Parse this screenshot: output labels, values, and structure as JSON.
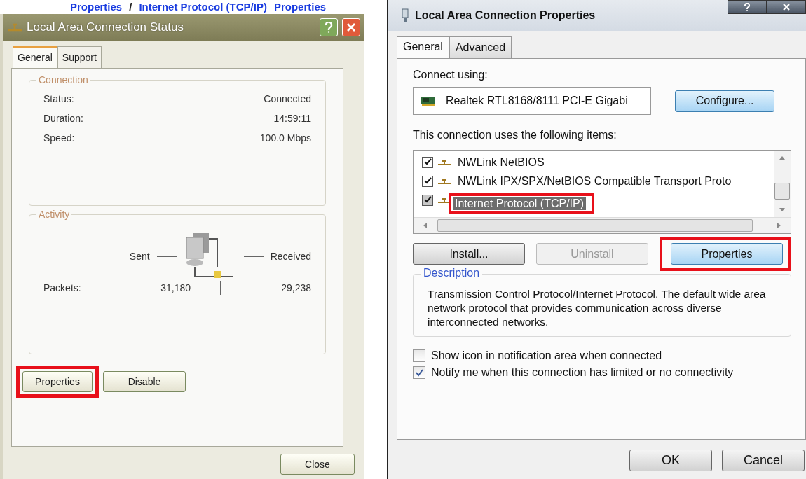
{
  "caption": [
    {
      "text": "Properties",
      "emphasis": true
    },
    {
      "text": "/",
      "emphasis": false
    },
    {
      "text": "Internet Protocol (TCP/IP)",
      "emphasis": true
    },
    {
      "text": "Properties",
      "emphasis": true
    }
  ],
  "status_window": {
    "title": "Local Area Connection Status",
    "tabs": [
      {
        "label": "General",
        "selected": true
      },
      {
        "label": "Support",
        "selected": false
      }
    ],
    "connection": {
      "legend": "Connection",
      "rows": [
        {
          "label": "Status:",
          "value": "Connected"
        },
        {
          "label": "Duration:",
          "value": "14:59:11"
        },
        {
          "label": "Speed:",
          "value": "100.0 Mbps"
        }
      ]
    },
    "activity": {
      "legend": "Activity",
      "sent_label": "Sent",
      "received_label": "Received",
      "packets_label": "Packets:",
      "sent": "31,180",
      "received": "29,238"
    },
    "buttons": [
      {
        "label": "Properties",
        "annotated": true
      },
      {
        "label": "Disable",
        "annotated": false
      }
    ],
    "close": "Close"
  },
  "properties_window": {
    "title": "Local Area Connection Properties",
    "tabs": [
      {
        "label": "General",
        "selected": true
      },
      {
        "label": "Advanced",
        "selected": false
      }
    ],
    "connect_using_label": "Connect using:",
    "adapter": "Realtek RTL8168/8111 PCI-E Gigabi",
    "configure": "Configure...",
    "items_label": "This connection uses the following items:",
    "items": [
      {
        "label": "NWLink NetBIOS",
        "checked": true,
        "selected": false,
        "annotated": false
      },
      {
        "label": "NWLink IPX/SPX/NetBIOS Compatible Transport Proto",
        "checked": true,
        "selected": false,
        "annotated": false
      },
      {
        "label": "Internet Protocol (TCP/IP)",
        "checked": true,
        "selected": true,
        "annotated": true
      }
    ],
    "item_buttons": [
      {
        "label": "Install...",
        "disabled": false,
        "focused": false,
        "annotated": false
      },
      {
        "label": "Uninstall",
        "disabled": true,
        "focused": false,
        "annotated": false
      },
      {
        "label": "Properties",
        "disabled": false,
        "focused": true,
        "annotated": true
      }
    ],
    "description_legend": "Description",
    "description": "Transmission Control Protocol/Internet Protocol. The default wide area network protocol that provides communication across diverse interconnected networks.",
    "options": [
      {
        "label": "Show icon in notification area when connected",
        "checked": false
      },
      {
        "label": "Notify me when this connection has limited or no connectivity",
        "checked": true
      }
    ],
    "footer_buttons": [
      "OK",
      "Cancel"
    ]
  }
}
